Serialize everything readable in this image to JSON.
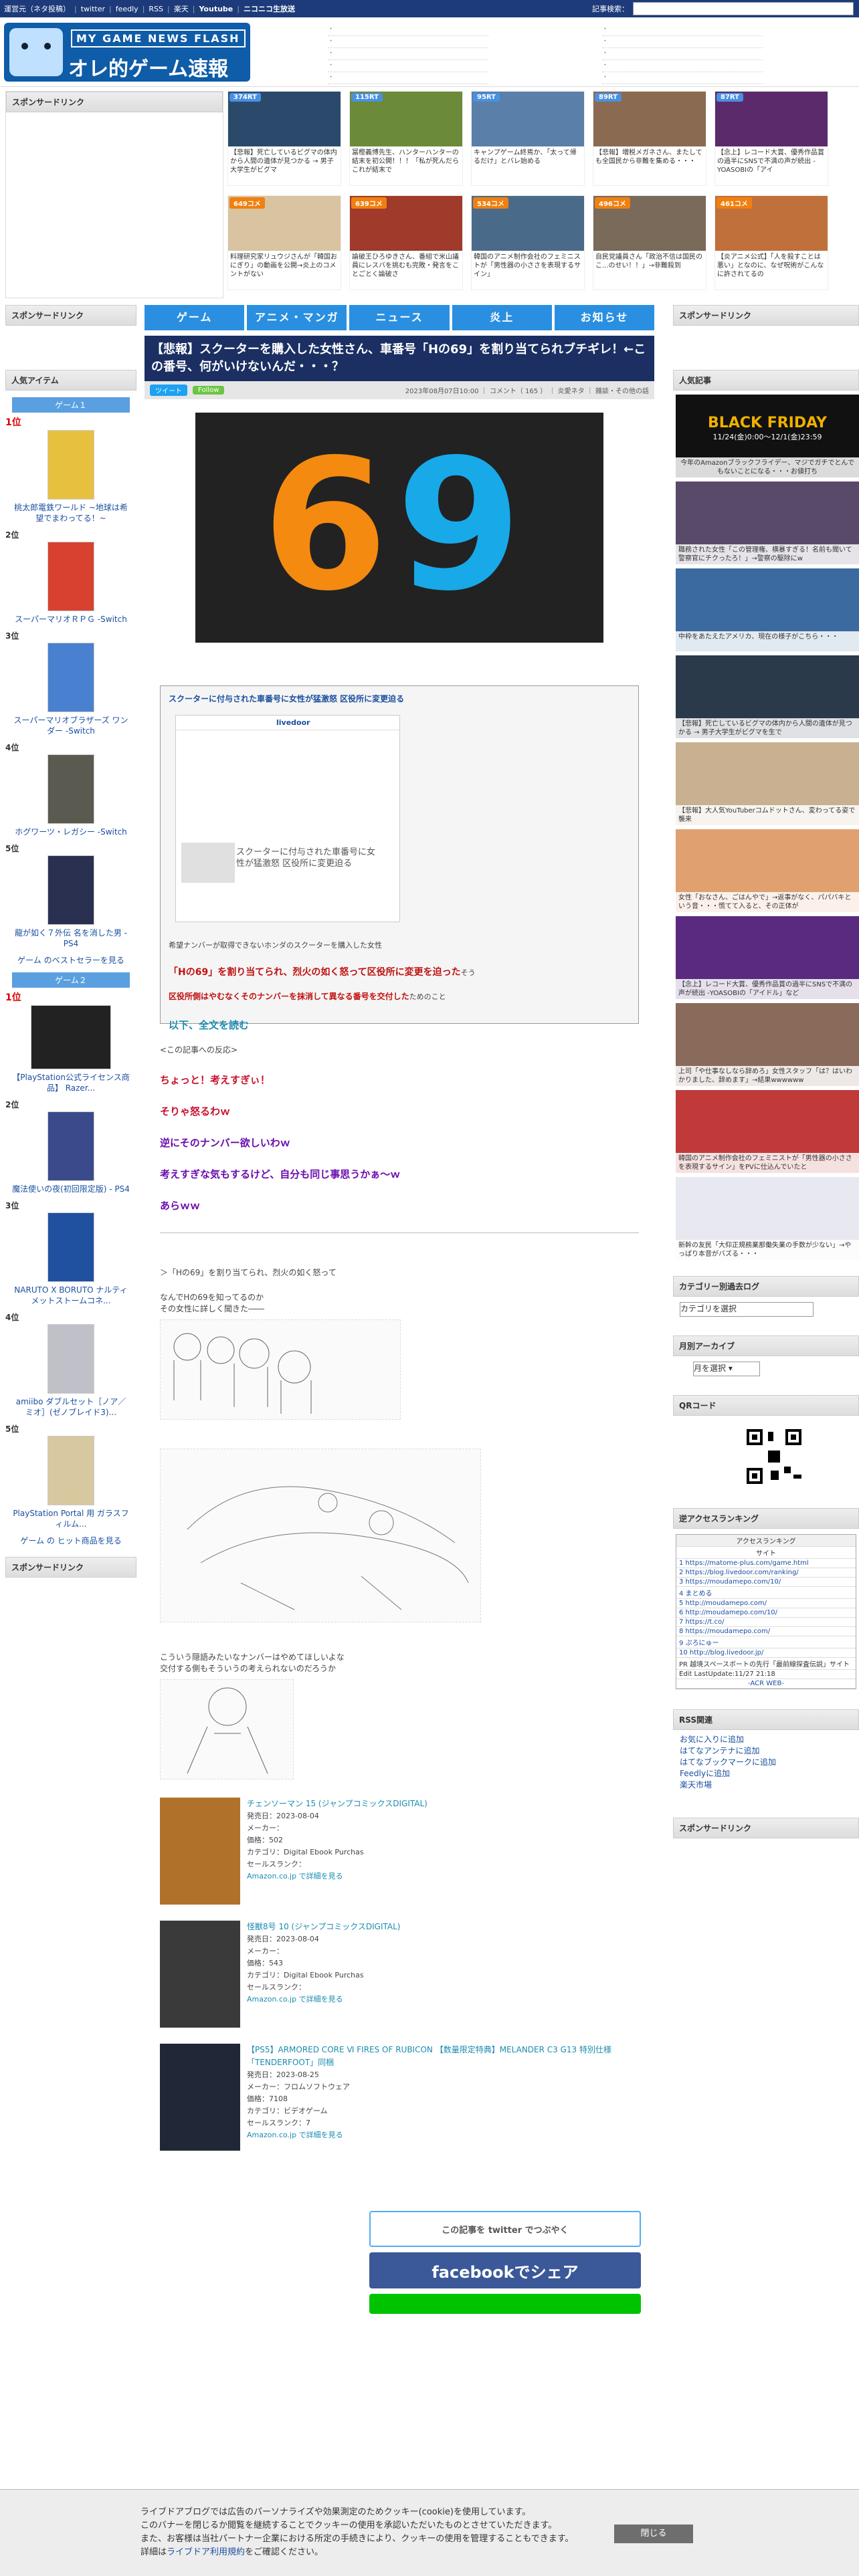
{
  "topbar": {
    "links": [
      "運営元（ネタ投稿）",
      "twitter",
      "feedly",
      "RSS",
      "楽天",
      "Youtube",
      "ニコニコ生放送"
    ],
    "search_label": "記事検索："
  },
  "header": {
    "logo_sub": "MY GAME NEWS FLASH",
    "logo_main": "オレ的ゲーム速報@JIN"
  },
  "left_sidebar": {
    "sponsor_label": "スポンサードリンク",
    "popular_label": "人気アイテム",
    "game1_tab": "ゲーム１",
    "game1_items": [
      {
        "rank": "1位",
        "title": "桃太郎電鉄ワールド ~地球は希望でまわってる！~"
      },
      {
        "rank": "2位",
        "title": "スーパーマリオＲＰＧ -Switch"
      },
      {
        "rank": "3位",
        "title": "スーパーマリオブラザーズ ワンダー -Switch"
      },
      {
        "rank": "4位",
        "title": "ホグワーツ・レガシー -Switch"
      },
      {
        "rank": "5位",
        "title": "龍が如く７外伝 名を消した男 - PS4"
      }
    ],
    "game1_more": "ゲーム のベストセラーを見る",
    "game2_tab": "ゲーム２",
    "game2_items": [
      {
        "rank": "1位",
        "title": "【PlayStation公式ライセンス商品】 Razer..."
      },
      {
        "rank": "2位",
        "title": "魔法使いの夜(初回限定版) - PS4"
      },
      {
        "rank": "3位",
        "title": "NARUTO X BORUTO ナルティメットストームコネ..."
      },
      {
        "rank": "4位",
        "title": "amiibo ダブルセット［ノア／ミオ］(ゼノブレイド3)..."
      },
      {
        "rank": "5位",
        "title": "PlayStation Portal 用 ガラスフィルム..."
      }
    ],
    "game2_more": "ゲーム の ヒット商品を見る",
    "sponsor_label_bottom": "スポンサードリンク"
  },
  "top_row": {
    "row1": [
      {
        "badge": "374RT",
        "caption": "【悲報】死亡しているビグマの体内から人間の遺体が見つかる → 男子大学生がビグマ"
      },
      {
        "badge": "115RT",
        "caption": "冨樫義博先生、ハンターハンターの結末を初公開！！！「私が死んだらこれが結末で"
      },
      {
        "badge": "95RT",
        "caption": "キャンプゲーム終焉か、「太って帰るだけ」とバレ始める"
      },
      {
        "badge": "89RT",
        "caption": "【悲報】増税メガネさん、またしても全国民から非難を集める・・・"
      },
      {
        "badge": "87RT",
        "caption": "【念上】レコード大賞、優秀作品賞の過半にSNSで不満の声が続出 -YOASOBIの「アイ"
      }
    ],
    "row2": [
      {
        "badge": "649コメ",
        "caption": "料理研究家リュウジさんが「韓国おにぎり」の動画を公開→炎上のコメントがない"
      },
      {
        "badge": "639コメ",
        "caption": "論破王ひろゆきさん、番組で米山議員にレスバを挑むも完敗・発言をことごとく論破さ"
      },
      {
        "badge": "534コメ",
        "caption": "韓国のアニメ制作会社のフェミニストが「男性器の小ささを表現するサイン」"
      },
      {
        "badge": "496コメ",
        "caption": "自民党議員さん「政治不信は国民のこ...のせい！！」→非難殺到"
      },
      {
        "badge": "461コメ",
        "caption": "【炎アニメ公式】「人を殺すことは悪い」となのに、なぜ呪術がこんなに許されてるの"
      }
    ],
    "sponsor_label": "スポンサードリンク"
  },
  "nav": [
    "ゲーム",
    "アニメ・マンガ",
    "ニュース",
    "炎上",
    "お知らせ"
  ],
  "article": {
    "title": "【悲報】スクーターを購入した女性さん、車番号「Hの69」を割り当てられブチギレ！←この番号、何がいけないんだ・・・？",
    "meta_tweet": "ツイート",
    "meta_follow": "Follow",
    "meta_info": "2023年08月07日10:00 ｜ コメント（ 165 ） ｜ 炎愛ネタ ｜ 雑談・その他の話",
    "hero_six": "6",
    "hero_nine": "9",
    "quote_title": "スクーターに付与された車番号に女性が猛激怒 区役所に変更迫る",
    "quote_shot_brand": "livedoor",
    "quote_shot_title": "スクーターに付与された車番号に女性が猛激怒 区役所に変更迫る",
    "quote_lead": "希望ナンバーが取得できないホンダのスクーターを購入した女性",
    "quote_red1": "「Hの69」を割り当てられ、烈火の如く怒って区役所に変更を迫った",
    "quote_red1_tail": "そう",
    "quote_red2": "区役所側はやむなくそのナンバーを抹消して異なる番号を交付した",
    "quote_red2_tail": "ためのこと",
    "quote_readmore": "以下、全文を読む",
    "reaction_lead": "<この記事への反応>",
    "reactions": [
      {
        "text": "ちょっと！考えすぎぃ！",
        "color": "#c8102e"
      },
      {
        "text": "そりゃ怒るわｗ",
        "color": "#c8102e"
      },
      {
        "text": "逆にそのナンバー欲しいわｗ",
        "color": "#6a0dad"
      },
      {
        "text": "考えすぎな気もするけど、自分も同じ事思うかぁ～ｗ",
        "color": "#6a0dad"
      },
      {
        "text": "あらｗｗ",
        "color": "#6a0dad"
      }
    ],
    "aa_line1": "＞「Hの69」を割り当てられ、烈火の如く怒って",
    "aa_line2": "なんでHの69を知ってるのか",
    "aa_line3": "その女性に詳しく聞きた――",
    "aa_line4": "こういう隠語みたいなナンバーはやめてほしいよな",
    "aa_line5": "交付する側もそういうの考えられないのだろうか",
    "amazon": [
      {
        "title": "チェンソーマン 15 (ジャンプコミックスDIGITAL)",
        "date": "発売日：2023-08-04",
        "maker": "メーカー：",
        "price": "価格：502",
        "category": "カテゴリ：Digital Ebook Purchas",
        "rank": "セールスランク：",
        "link": "Amazon.co.jp で詳細を見る"
      },
      {
        "title": "怪獣8号 10 (ジャンプコミックスDIGITAL)",
        "date": "発売日：2023-08-04",
        "maker": "メーカー：",
        "price": "価格：543",
        "category": "カテゴリ：Digital Ebook Purchas",
        "rank": "セールスランク：",
        "link": "Amazon.co.jp で詳細を見る"
      },
      {
        "title": "【PS5】ARMORED CORE Ⅵ FIRES OF RUBICON 【数量限定特典】MELANDER C3 G13 特別仕様「TENDERFOOT」同梱",
        "date": "発売日：2023-08-25",
        "maker": "メーカー：フロムソフトウェア",
        "price": "価格：7108",
        "category": "カテゴリ：ビデオゲーム",
        "rank": "セールスランク：7",
        "link": "Amazon.co.jp で詳細を見る"
      }
    ],
    "share_twitter": "この記事を twitter でつぶやく",
    "share_facebook": "facebookでシェア"
  },
  "right_sidebar": {
    "sponsor_label": "スポンサードリンク",
    "popular_label": "人気記事",
    "popular": [
      "今年のAmazonブラックフライデー、マジでガチでとんでもないことになる・・・お値打ち",
      "職務された女性「この管理権、横暴すぎる！名前も聞いて警察官にチクったろ！」→警察の駆除にw",
      "中枠をあたえたアメリカ、現在の様子がこちら・・・",
      "【悲報】死亡しているビグマの体内から人間の遺体が見つかる → 男子大学生がビグマを生で",
      "【悲報】大人気YouTuberコムドットさん、変わってる姿で襲来",
      "女性「おなさん、ごはんやで」→返事がなく、パパバキという音・・・慌てて入ると、その正体が",
      "【念上】レコード大賞、優秀作品賞の過半にSNSで不満の声が続出 -YOASOBIの「アイドル」など",
      "上司「や仕事なしなら辞めろ」女性スタッフ「は？はいわかりました、辞めます」→結果wwwwww",
      "韓国のアニメ制作会社のフェミニストが「男性器の小ささを表現するサイン」をPVに仕込んでいたと",
      "新幹の友民「大仰正規務業那働失業の手数が少ない」→やっぱり本音がバズる・・・"
    ],
    "black_friday_line1": "BLACK FRIDAY",
    "black_friday_date": "11/24(金)0:00～12/1(金)23:59",
    "category_label": "カテゴリー別過去ログ",
    "category_select": "カテゴリを選択",
    "archive_label": "月別アーカイブ",
    "archive_select": "月を選択",
    "qr_label": "QRコード",
    "access_label": "逆アクセスランキング",
    "access_header": "アクセスランキング",
    "access_col": "サイト",
    "access_rows": [
      "1 https://matome-plus.com/game.html",
      "2 https://blog.livedoor.com/ranking/",
      "3 https://moudamepo.com/10/",
      "4 まとめる",
      "5 http://moudamepo.com/",
      "6 http://moudamepo.com/10/",
      "7 https://t.co/",
      "8 https://moudamepo.com/",
      "9 ぷろにゅー",
      "10 http://blog.livedoor.jp/"
    ],
    "access_pr": "PR 越境スペースボートの先行「最前線探査伝説」サイト",
    "access_edit": "Edit LastUpdate:11/27 21:18",
    "access_footer": "-ACR WEB-",
    "rss_label": "RSS関連",
    "rss_links": [
      "お気に入りに追加",
      "はてなアンテナに追加",
      "はてなブックマークに追加",
      "Feedlyに追加",
      "楽天市場"
    ],
    "sponsor_label_bottom": "スポンサードリンク"
  },
  "cookie": {
    "line1": "ライブドアブログでは広告のパーソナライズや効果測定のためクッキー(cookie)を使用しています。",
    "line2": "このバナーを閉じるか閲覧を継続することでクッキーの使用を承認いただいたものとさせていただきます。",
    "line3": "また、お客様は当社パートナー企業における所定の手続きにより、クッキーの使用を管理することもできます。",
    "line4_pre": "詳細は",
    "line4_link": "ライブドア利用規約",
    "line4_post": "をご確認ください。",
    "close": "閉じる"
  }
}
